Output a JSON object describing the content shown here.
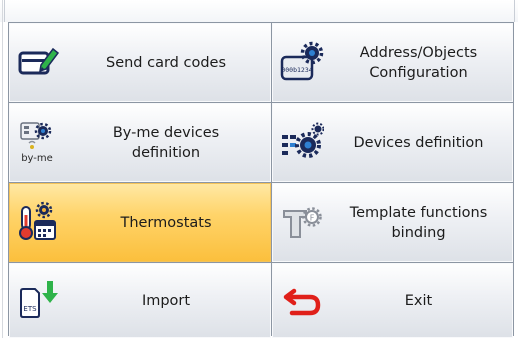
{
  "colors": {
    "tile_gradient_top": "#ffffff",
    "tile_gradient_bottom": "#dde1e7",
    "active_tile": "#fbbf3c",
    "border": "#8c96a3"
  },
  "tiles": [
    {
      "id": "send-card-codes",
      "label": "Send card codes",
      "icon": "card-pencil-icon",
      "active": false
    },
    {
      "id": "address-objects-configuration",
      "label": "Address/Objects\nConfiguration",
      "icon": "address-gear-icon",
      "active": false
    },
    {
      "id": "by-me-devices-definition",
      "label": "By-me devices\ndefinition",
      "icon": "byme-gear-icon",
      "active": false
    },
    {
      "id": "devices-definition",
      "label": "Devices definition",
      "icon": "devices-gear-icon",
      "active": false
    },
    {
      "id": "thermostats",
      "label": "Thermostats",
      "icon": "thermometer-calendar-icon",
      "active": true
    },
    {
      "id": "template-functions-binding",
      "label": "Template functions\nbinding",
      "icon": "template-gear-icon",
      "active": false
    },
    {
      "id": "import",
      "label": "Import",
      "icon": "ets-import-icon",
      "active": false
    },
    {
      "id": "exit",
      "label": "Exit",
      "icon": "exit-arrow-icon",
      "active": false
    }
  ],
  "icon_text": {
    "address": "000b1234",
    "byme": "by-me",
    "ets": "ETS"
  }
}
